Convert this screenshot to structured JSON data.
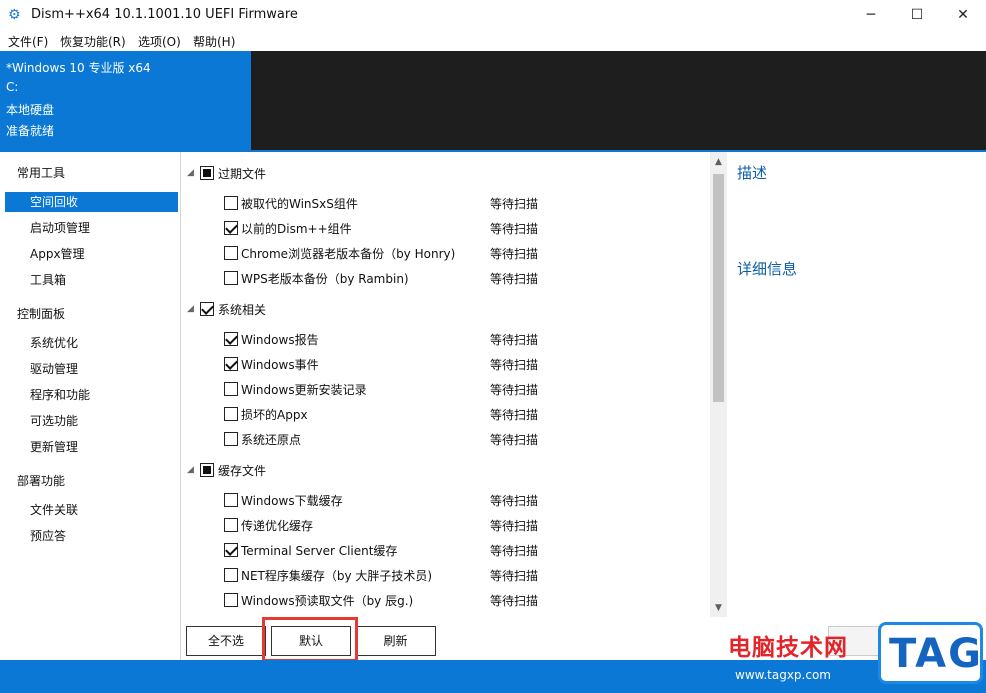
{
  "window": {
    "title": "Dism++x64 10.1.1001.10 UEFI Firmware",
    "app_icon": "gears-icon",
    "controls": {
      "minimize": "─",
      "maximize": "☐",
      "close": "✕"
    }
  },
  "menubar": [
    "文件(F)",
    "恢复功能(R)",
    "选项(O)",
    "帮助(H)"
  ],
  "system_info": {
    "os": "*Windows 10 专业版 x64",
    "drive": "C:",
    "disk": "本地硬盘",
    "status": "准备就绪"
  },
  "sidebar": {
    "groups": [
      {
        "label": "常用工具",
        "items": [
          "空间回收",
          "启动项管理",
          "Appx管理",
          "工具箱"
        ]
      },
      {
        "label": "控制面板",
        "items": [
          "系统优化",
          "驱动管理",
          "程序和功能",
          "可选功能",
          "更新管理"
        ]
      },
      {
        "label": "部署功能",
        "items": [
          "文件关联",
          "预应答"
        ]
      }
    ],
    "selected": "空间回收"
  },
  "cleanup": {
    "groups": [
      {
        "label": "过期文件",
        "state": "partial",
        "items": [
          {
            "label": "被取代的WinSxS组件",
            "checked": false,
            "status": "等待扫描"
          },
          {
            "label": "以前的Dism++组件",
            "checked": true,
            "status": "等待扫描"
          },
          {
            "label": "Chrome浏览器老版本备份（by Honry)",
            "checked": false,
            "status": "等待扫描"
          },
          {
            "label": "WPS老版本备份（by Rambin)",
            "checked": false,
            "status": "等待扫描"
          }
        ]
      },
      {
        "label": "系统相关",
        "state": "checked",
        "items": [
          {
            "label": "Windows报告",
            "checked": true,
            "status": "等待扫描"
          },
          {
            "label": "Windows事件",
            "checked": true,
            "status": "等待扫描"
          },
          {
            "label": "Windows更新安装记录",
            "checked": false,
            "status": "等待扫描"
          },
          {
            "label": "损坏的Appx",
            "checked": false,
            "status": "等待扫描"
          },
          {
            "label": "系统还原点",
            "checked": false,
            "status": "等待扫描"
          }
        ]
      },
      {
        "label": "缓存文件",
        "state": "partial",
        "items": [
          {
            "label": "Windows下载缓存",
            "checked": false,
            "status": "等待扫描"
          },
          {
            "label": "传递优化缓存",
            "checked": false,
            "status": "等待扫描"
          },
          {
            "label": "Terminal Server Client缓存",
            "checked": true,
            "status": "等待扫描"
          },
          {
            "label": "NET程序集缓存（by 大胖子技术员)",
            "checked": false,
            "status": "等待扫描"
          },
          {
            "label": "Windows预读取文件（by 辰g.)",
            "checked": false,
            "status": "等待扫描"
          }
        ]
      }
    ]
  },
  "right_panel": {
    "description": "描述",
    "details": "详细信息"
  },
  "buttons": {
    "deselect_all": "全不选",
    "default": "默认",
    "refresh": "刷新"
  },
  "watermark": {
    "text": "电脑技术网",
    "url": "www.tagxp.com",
    "tag": "TAG"
  },
  "colors": {
    "accent": "#0a78d4",
    "header_dark": "#1e1e1e",
    "highlight": "#e53935",
    "link": "#0b5fa8"
  }
}
